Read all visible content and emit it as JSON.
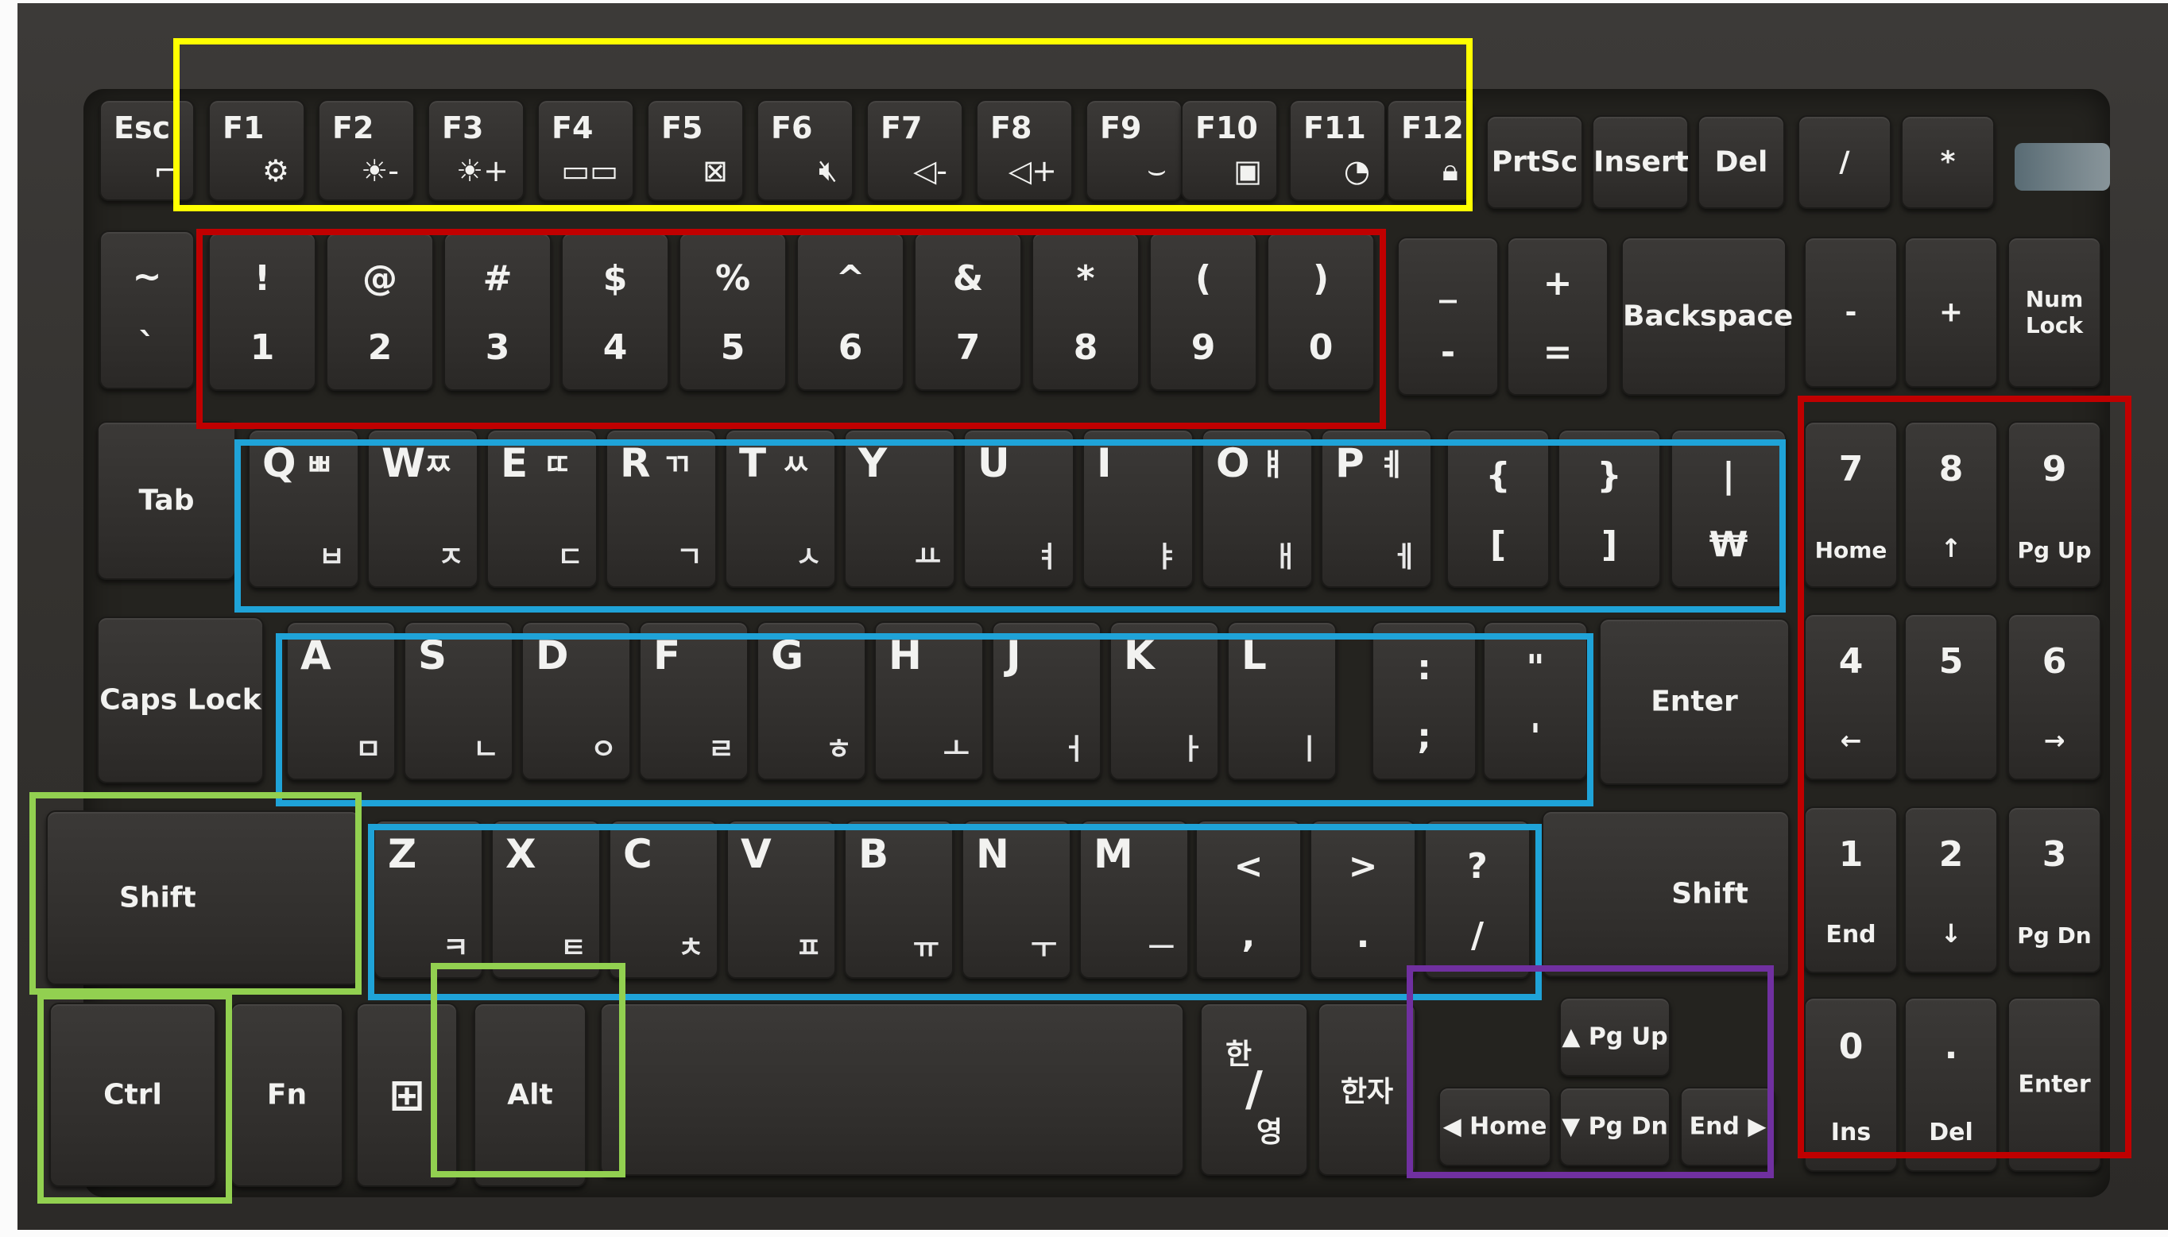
{
  "colors": {
    "yellow": "#ffff00",
    "red": "#c00000",
    "blue": "#1fa3d8",
    "green": "#92d050",
    "purple": "#7030a0"
  },
  "keys": {
    "esc": "Esc",
    "f1": "F1",
    "f2": "F2",
    "f3": "F3",
    "f4": "F4",
    "f5": "F5",
    "f6": "F6",
    "f7": "F7",
    "f8": "F8",
    "f9": "F9",
    "f10": "F10",
    "f11": "F11",
    "f12": "F12",
    "prtsc": "PrtSc",
    "insert": "Insert",
    "del": "Del",
    "np_slash": "/",
    "np_star": "*",
    "tilde_top": "~",
    "tilde_bot": "`",
    "num": [
      {
        "top": "!",
        "bot": "1"
      },
      {
        "top": "@",
        "bot": "2"
      },
      {
        "top": "#",
        "bot": "3"
      },
      {
        "top": "$",
        "bot": "4"
      },
      {
        "top": "%",
        "bot": "5"
      },
      {
        "top": "^",
        "bot": "6"
      },
      {
        "top": "&",
        "bot": "7"
      },
      {
        "top": "*",
        "bot": "8"
      },
      {
        "top": "(",
        "bot": "9"
      },
      {
        "top": ")",
        "bot": "0"
      }
    ],
    "minus_top": "_",
    "minus_bot": "-",
    "equal_top": "+",
    "equal_bot": "=",
    "backspace": "Backspace",
    "np_minus": "-",
    "np_plus": "+",
    "numlock": "Num Lock",
    "tab": "Tab",
    "qrow": [
      {
        "l": "Q",
        "h1": "ㅃ",
        "h2": "ㅂ"
      },
      {
        "l": "W",
        "h1": "ㅉ",
        "h2": "ㅈ"
      },
      {
        "l": "E",
        "h1": "ㄸ",
        "h2": "ㄷ"
      },
      {
        "l": "R",
        "h1": "ㄲ",
        "h2": "ㄱ"
      },
      {
        "l": "T",
        "h1": "ㅆ",
        "h2": "ㅅ"
      },
      {
        "l": "Y",
        "h1": "",
        "h2": "ㅛ"
      },
      {
        "l": "U",
        "h1": "",
        "h2": "ㅕ"
      },
      {
        "l": "I",
        "h1": "",
        "h2": "ㅑ"
      },
      {
        "l": "O",
        "h1": "ㅒ",
        "h2": "ㅐ"
      },
      {
        "l": "P",
        "h1": "ㅖ",
        "h2": "ㅔ"
      }
    ],
    "lbrace_top": "{",
    "lbrace_bot": "[",
    "rbrace_top": "}",
    "rbrace_bot": "]",
    "pipe_top": "|",
    "pipe_bot": "₩",
    "capslock": "Caps Lock",
    "arow": [
      {
        "l": "A",
        "h": "ㅁ"
      },
      {
        "l": "S",
        "h": "ㄴ"
      },
      {
        "l": "D",
        "h": "ㅇ"
      },
      {
        "l": "F",
        "h": "ㄹ"
      },
      {
        "l": "G",
        "h": "ㅎ"
      },
      {
        "l": "H",
        "h": "ㅗ"
      },
      {
        "l": "J",
        "h": "ㅓ"
      },
      {
        "l": "K",
        "h": "ㅏ"
      },
      {
        "l": "L",
        "h": "ㅣ"
      }
    ],
    "colon_top": ":",
    "colon_bot": ";",
    "quote_top": "\"",
    "quote_bot": "'",
    "enter": "Enter",
    "shift": "Shift",
    "zrow": [
      {
        "l": "Z",
        "h": "ㅋ"
      },
      {
        "l": "X",
        "h": "ㅌ"
      },
      {
        "l": "C",
        "h": "ㅊ"
      },
      {
        "l": "V",
        "h": "ㅍ"
      },
      {
        "l": "B",
        "h": "ㅠ"
      },
      {
        "l": "N",
        "h": "ㅜ"
      },
      {
        "l": "M",
        "h": "ㅡ"
      }
    ],
    "lt_top": "<",
    "lt_bot": ",",
    "gt_top": ">",
    "gt_bot": ".",
    "q_top": "?",
    "q_bot": "/",
    "ctrl": "Ctrl",
    "fn": "Fn",
    "alt": "Alt",
    "hanyeong_top": "한",
    "hanyeong_bot": "영",
    "hanja": "한자",
    "pgup": "▲ Pg Up",
    "pgdn": "▼ Pg Dn",
    "home": "◀ Home",
    "end": "End ▶",
    "np7": {
      "t": "7",
      "b": "Home"
    },
    "np8": {
      "t": "8",
      "b": "↑"
    },
    "np9": {
      "t": "9",
      "b": "Pg Up"
    },
    "np4": {
      "t": "4",
      "b": "←"
    },
    "np5": {
      "t": "5",
      "b": ""
    },
    "np6": {
      "t": "6",
      "b": "→"
    },
    "np1": {
      "t": "1",
      "b": "End"
    },
    "np2": {
      "t": "2",
      "b": "↓"
    },
    "np3": {
      "t": "3",
      "b": "Pg Dn"
    },
    "np0": {
      "t": "0",
      "b": "Ins"
    },
    "npdot": {
      "t": ".",
      "b": "Del"
    },
    "npenter": "Enter"
  }
}
